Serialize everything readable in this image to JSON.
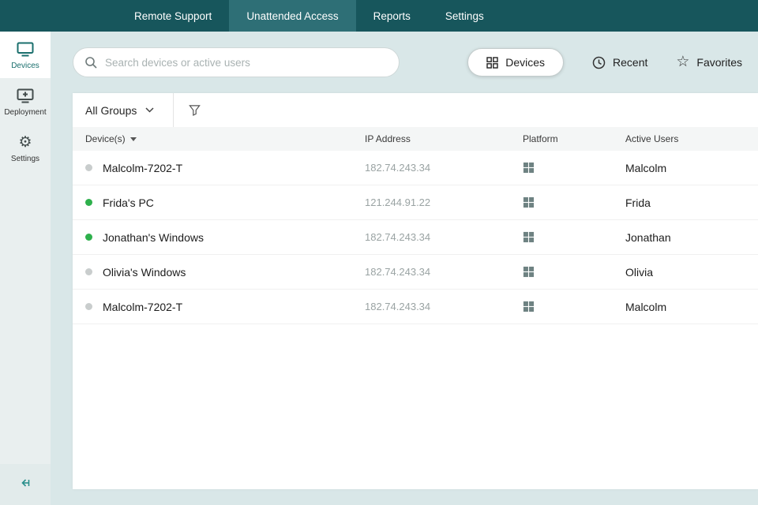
{
  "topnav": {
    "items": [
      {
        "label": "Remote Support"
      },
      {
        "label": "Unattended Access"
      },
      {
        "label": "Reports"
      },
      {
        "label": "Settings"
      }
    ]
  },
  "sidebar": {
    "items": [
      {
        "label": "Devices"
      },
      {
        "label": "Deployment"
      },
      {
        "label": "Settings"
      }
    ]
  },
  "toolbar": {
    "search_placeholder": "Search devices or active users",
    "views": [
      {
        "label": "Devices"
      },
      {
        "label": "Recent"
      },
      {
        "label": "Favorites"
      }
    ]
  },
  "filterbar": {
    "group_selector": "All Groups"
  },
  "table": {
    "columns": [
      "Device(s)",
      "IP Address",
      "Platform",
      "Active Users"
    ],
    "rows": [
      {
        "status": "offline",
        "device": "Malcolm-7202-T",
        "ip": "182.74.243.34",
        "platform": "windows",
        "user": "Malcolm"
      },
      {
        "status": "online",
        "device": "Frida's PC",
        "ip": "121.244.91.22",
        "platform": "windows",
        "user": "Frida"
      },
      {
        "status": "online",
        "device": "Jonathan's Windows",
        "ip": "182.74.243.34",
        "platform": "windows",
        "user": "Jonathan"
      },
      {
        "status": "offline",
        "device": "Olivia's Windows",
        "ip": "182.74.243.34",
        "platform": "windows",
        "user": "Olivia"
      },
      {
        "status": "offline",
        "device": "Malcolm-7202-T",
        "ip": "182.74.243.34",
        "platform": "windows",
        "user": "Malcolm"
      }
    ]
  },
  "colors": {
    "topbar": "#17565c",
    "topbar_active_tab": "#2e6f76",
    "sidebar_bg": "#e9efef",
    "content_bg": "#d9e7e8",
    "accent_teal": "#1a6f6d",
    "status_online": "#2eb04c",
    "status_offline": "#c9cdcd"
  }
}
